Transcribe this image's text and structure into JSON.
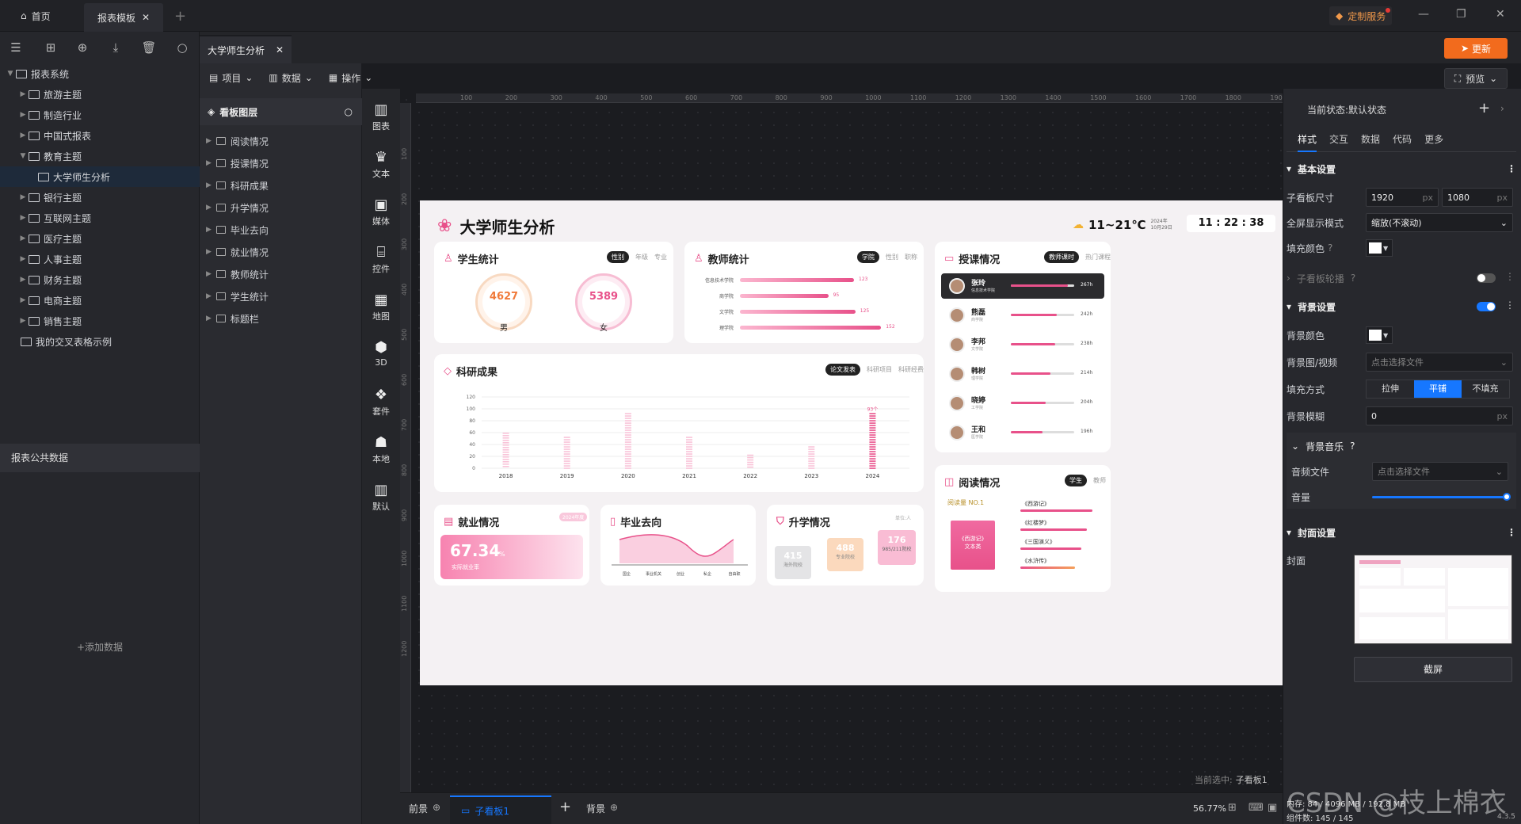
{
  "titlebar": {
    "home": "首页",
    "tab_template": "报表模板",
    "custom_service": "定制服务"
  },
  "toolbar": {
    "update": "更新",
    "preview": "预览"
  },
  "tree": {
    "root": "报表系统",
    "items": [
      "旅游主题",
      "制造行业",
      "中国式报表",
      "教育主题",
      "大学师生分析",
      "银行主题",
      "互联网主题",
      "医疗主题",
      "人事主题",
      "财务主题",
      "电商主题",
      "销售主题",
      "我的交叉表格示例"
    ],
    "public_data": "报表公共数据",
    "add_data": "+添加数据"
  },
  "editor": {
    "active_tab": "大学师生分析"
  },
  "menu": {
    "project": "项目",
    "data": "数据",
    "operation": "操作"
  },
  "layers": {
    "title": "看板图层",
    "items": [
      "阅读情况",
      "授课情况",
      "科研成果",
      "升学情况",
      "毕业去向",
      "就业情况",
      "教师统计",
      "学生统计",
      "标题栏"
    ]
  },
  "components": [
    "图表",
    "文本",
    "媒体",
    "控件",
    "地图",
    "3D",
    "套件",
    "本地",
    "默认"
  ],
  "ruler": {
    "h": [
      "100",
      "200",
      "300",
      "400",
      "500",
      "600",
      "700",
      "800",
      "900",
      "1000",
      "1100",
      "1200",
      "1300",
      "1400",
      "1500",
      "1600",
      "1700",
      "1800",
      "1900"
    ],
    "v": [
      "100",
      "200",
      "300",
      "400",
      "500",
      "600",
      "700",
      "800",
      "900",
      "1000",
      "1100",
      "1200"
    ]
  },
  "dashboard": {
    "title": "大学师生分析",
    "weather": "11~21℃",
    "date": "2024年\n10月29日",
    "time": "11 : 22 : 38",
    "student": {
      "title": "学生统计",
      "tabs": [
        "性别",
        "年级",
        "专业"
      ],
      "male": "4627",
      "female": "5389",
      "male_label": "男",
      "female_label": "女"
    },
    "teacher": {
      "title": "教师统计",
      "tabs": [
        "学院",
        "性别",
        "职称"
      ],
      "rows": [
        {
          "name": "信息技术学院",
          "value": "123",
          "ratio": 0.8
        },
        {
          "name": "商学院",
          "value": "95",
          "ratio": 0.62
        },
        {
          "name": "文学院",
          "value": "125",
          "ratio": 0.81
        },
        {
          "name": "理学院",
          "value": "152",
          "ratio": 0.99
        }
      ]
    },
    "research": {
      "title": "科研成果",
      "tabs": [
        "论文发表",
        "科研项目",
        "科研经费"
      ],
      "yticks": [
        "0",
        "20",
        "40",
        "60",
        "80",
        "100",
        "120"
      ],
      "peak_label": "93个"
    },
    "lectures": {
      "title": "授课情况",
      "tabs": [
        "教师课时",
        "热门课程"
      ],
      "rows": [
        {
          "name": "张玲",
          "dept": "信息技术学院",
          "value": "267h",
          "ratio": 0.9
        },
        {
          "name": "熊磊",
          "dept": "商学院",
          "value": "242h",
          "ratio": 0.72
        },
        {
          "name": "李邦",
          "dept": "文学院",
          "value": "238h",
          "ratio": 0.7
        },
        {
          "name": "韩树",
          "dept": "理学院",
          "value": "214h",
          "ratio": 0.62
        },
        {
          "name": "晓婷",
          "dept": "工学院",
          "value": "204h",
          "ratio": 0.55
        },
        {
          "name": "王和",
          "dept": "医学院",
          "value": "196h",
          "ratio": 0.5
        }
      ]
    },
    "employment": {
      "title": "就业情况",
      "rate": "67.34",
      "unit": "%",
      "label": "实际就业率",
      "badge": "2024年度"
    },
    "destination": {
      "title": "毕业去向",
      "cats": [
        "国企",
        "事业机关",
        "创业",
        "私企",
        "自由职"
      ]
    },
    "further": {
      "title": "升学情况",
      "unit": "单位:人",
      "abroad": "415",
      "abroad_label": "海外院校",
      "pro": "488",
      "pro_label": "专业院校",
      "top": "176",
      "top_label": "985/211院校"
    },
    "reading": {
      "title": "阅读情况",
      "tabs": [
        "学生",
        "教师"
      ],
      "badge": "阅读量 NO.1",
      "book": "《西游记》",
      "book_sub": "文本类",
      "books": [
        {
          "name": "《西游记》",
          "ratio": 0.95
        },
        {
          "name": "《红楼梦》",
          "ratio": 0.88
        },
        {
          "name": "《三国演义》",
          "ratio": 0.8
        },
        {
          "name": "《水浒传》",
          "ratio": 0.72
        }
      ]
    }
  },
  "chart_data": {
    "type": "bar",
    "title": "科研成果",
    "categories": [
      "2018",
      "2019",
      "2020",
      "2021",
      "2022",
      "2023",
      "2024"
    ],
    "values": [
      60,
      53,
      93,
      53,
      23,
      37,
      93
    ],
    "ylim": [
      0,
      120
    ]
  },
  "bottom": {
    "foreground": "前景",
    "subboard": "子看板1",
    "background": "背景",
    "zoom": "56.77%",
    "current": "当前选中:",
    "current_val": "子看板1"
  },
  "status": {
    "memory": "内存: 84 / 4096 MB / 192.8 MB",
    "components": "组件数: 145 / 145",
    "version": "4.3.5"
  },
  "rightpanel": {
    "state": "当前状态:默认状态",
    "tabs": [
      "样式",
      "交互",
      "数据",
      "代码",
      "更多"
    ],
    "basic": "基本设置",
    "size_label": "子看板尺寸",
    "w": "1920",
    "h": "1080",
    "unit": "px",
    "fullscreen_label": "全屏显示模式",
    "fullscreen": "缩放(不滚动)",
    "fill_label": "填充颜色",
    "carousel": "子看板轮播",
    "bg_section": "背景设置",
    "bg_color": "背景颜色",
    "bg_image": "背景图/视频",
    "pick_file": "点击选择文件",
    "fill_mode": "填充方式",
    "fill_opts": [
      "拉伸",
      "平铺",
      "不填充"
    ],
    "bg_blur": "背景模糊",
    "blur_val": "0",
    "bg_music": "背景音乐",
    "audio_file": "音频文件",
    "volume": "音量",
    "cover_section": "封面设置",
    "cover": "封面",
    "screenshot": "截屏"
  },
  "watermark": "CSDN @枝上棉衣",
  "colors": {
    "accent": "#1677ff",
    "brand": "#e8518a",
    "update": "#f26b1d"
  }
}
